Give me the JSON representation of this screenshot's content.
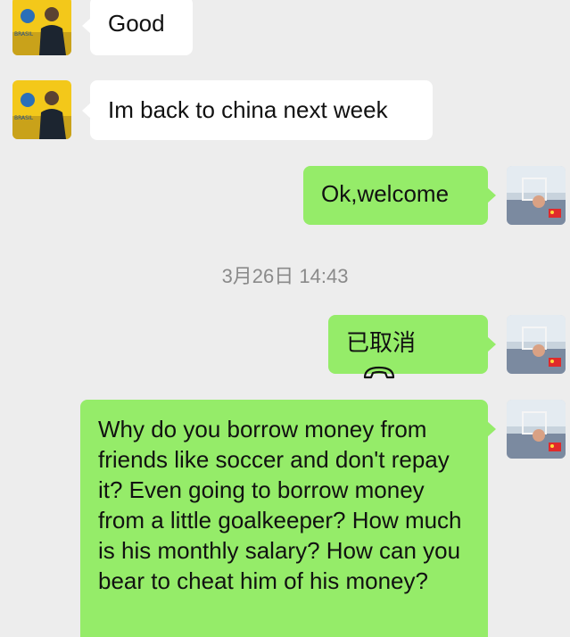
{
  "messages": [
    {
      "side": "left",
      "text": "Good"
    },
    {
      "side": "left",
      "text": "Im back to china next week"
    },
    {
      "side": "right",
      "text": "Ok,welcome"
    },
    {
      "side": "right",
      "type": "call",
      "text": "已取消",
      "icon": "hangup-phone-icon"
    },
    {
      "side": "right",
      "text": "Why do you borrow money from friends like soccer and don't repay it? Even going to borrow money from a little goalkeeper? How much is his monthly salary? How can you bear to cheat him of his money?"
    }
  ],
  "timestamp": "3月26日 14:43",
  "colors": {
    "background": "#ededed",
    "outgoing_bubble": "#95ec69",
    "incoming_bubble": "#ffffff",
    "timestamp_text": "#8a8a8a"
  }
}
